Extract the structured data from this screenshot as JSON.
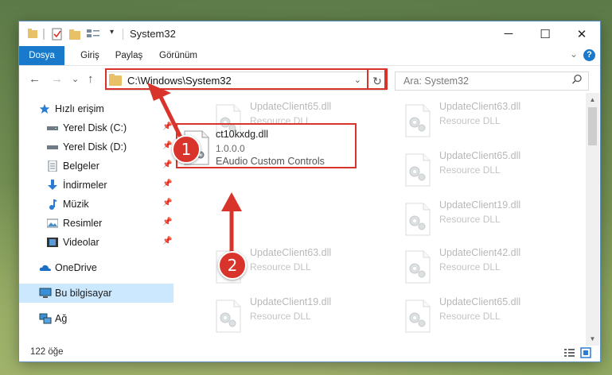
{
  "window": {
    "title": "System32",
    "quick_access_toolbar_dropdown": "▾"
  },
  "window_controls": {
    "minimize": "─",
    "maximize": "☐",
    "close": "✕"
  },
  "ribbon": {
    "tabs": [
      "Dosya",
      "Giriş",
      "Paylaş",
      "Görünüm"
    ],
    "expand": "⌄",
    "help": "?"
  },
  "navigation": {
    "back": "←",
    "forward": "→",
    "recent": "⌄",
    "up": "↑",
    "address": "C:\\Windows\\System32",
    "address_dropdown": "⌄",
    "refresh": "↻",
    "search_placeholder": "Ara: System32"
  },
  "sidebar": {
    "items": [
      {
        "label": "Hızlı erişim",
        "icon": "star-icon"
      },
      {
        "label": "Yerel Disk (C:)",
        "icon": "drive-icon",
        "pinned": true
      },
      {
        "label": "Yerel Disk (D:)",
        "icon": "drive-icon",
        "pinned": true
      },
      {
        "label": "Belgeler",
        "icon": "documents-icon",
        "pinned": true
      },
      {
        "label": "İndirmeler",
        "icon": "download-icon",
        "pinned": true
      },
      {
        "label": "Müzik",
        "icon": "music-icon",
        "pinned": true
      },
      {
        "label": "Resimler",
        "icon": "pictures-icon",
        "pinned": true
      },
      {
        "label": "Videolar",
        "icon": "videos-icon",
        "pinned": true
      },
      {
        "label": "OneDrive",
        "icon": "cloud-icon"
      },
      {
        "label": "Bu bilgisayar",
        "icon": "computer-icon",
        "selected": true
      },
      {
        "label": "Ağ",
        "icon": "network-icon"
      }
    ]
  },
  "files": [
    {
      "name": "UpdateClient65.dll",
      "desc": "Resource DLL"
    },
    {
      "name": "UpdateClient63.dll",
      "desc": "Resource DLL"
    },
    {
      "name": "UpdateClient65.dll",
      "desc": "Resource DLL"
    },
    {
      "name": "UpdateClient19.dll",
      "desc": "Resource DLL"
    },
    {
      "name": "UpdateClient63.dll",
      "desc": "Resource DLL"
    },
    {
      "name": "UpdateClient42.dll",
      "desc": "Resource DLL"
    },
    {
      "name": "UpdateClient19.dll",
      "desc": "Resource DLL"
    },
    {
      "name": "UpdateClient65.dll",
      "desc": "Resource DLL"
    }
  ],
  "featured_file": {
    "name": "ct10kxdg.dll",
    "version": "1.0.0.0",
    "desc": "EAudio Custom Controls"
  },
  "annotations": {
    "step1": "1",
    "step2": "2"
  },
  "status": {
    "count": "122 öğe"
  },
  "colors": {
    "accent": "#1979ca",
    "highlight": "#d9342c",
    "selection": "#cce8ff"
  }
}
